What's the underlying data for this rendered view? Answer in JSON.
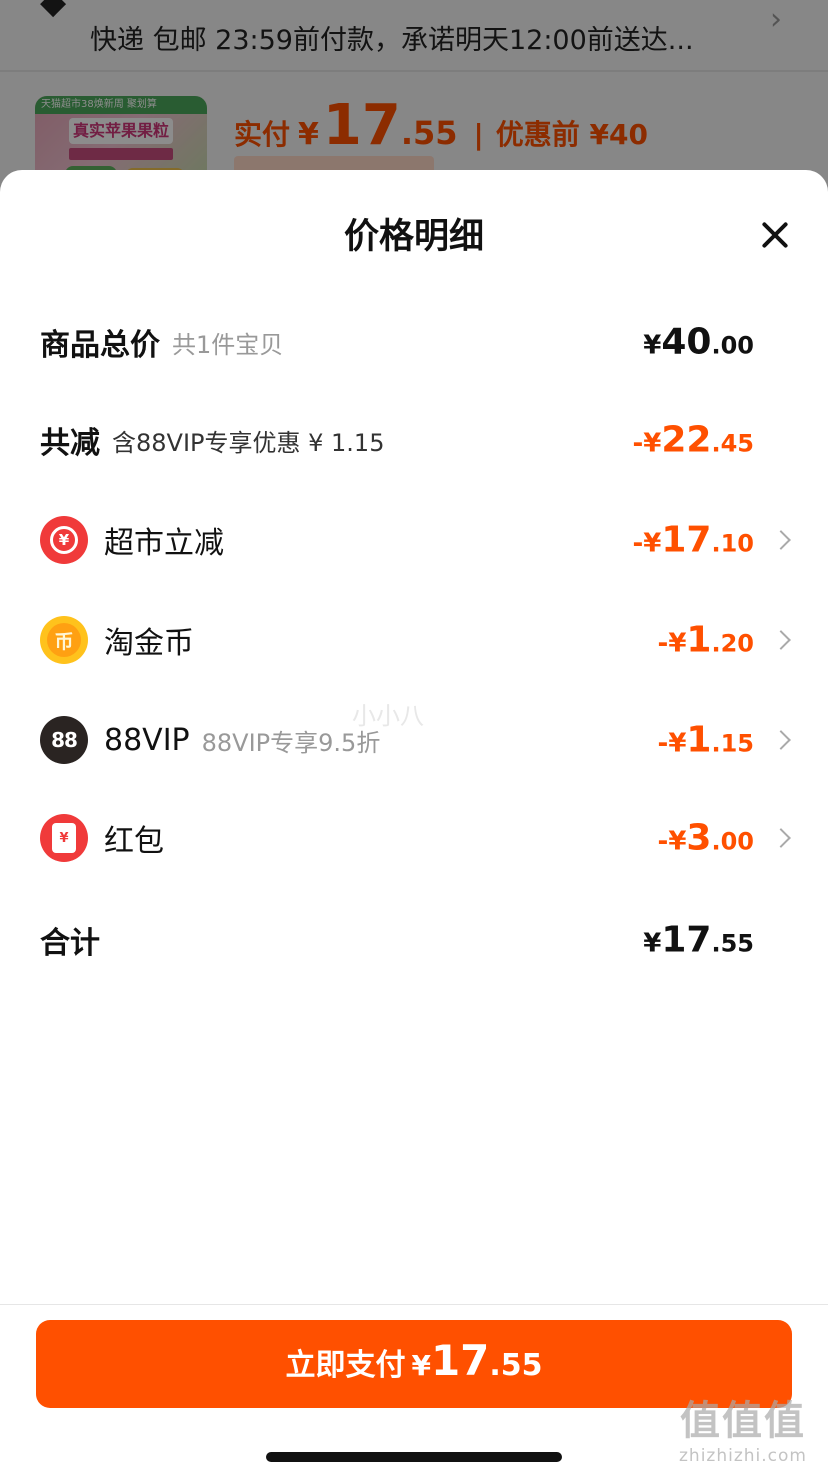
{
  "background": {
    "delivery_text": "快递 包邮 23:59前付款，承诺明天12:00前送达...",
    "product_thumb_title": "真实苹果果粒",
    "product_thumb_banner": "天猫超市38焕新周 聚划算",
    "price_label": "实付",
    "price_yen": "¥",
    "price_int": "17",
    "price_dec": ".55",
    "price_separator": "|",
    "price_before": "优惠前 ¥40"
  },
  "sheet": {
    "title": "价格明细",
    "rows": [
      {
        "label": "商品总价",
        "sub": "共1件宝贝",
        "sign": "¥",
        "int": "40",
        "dec": ".00"
      },
      {
        "label": "共减",
        "sub": "含88VIP专享优惠 ¥ 1.15",
        "sign": "-¥",
        "int": "22",
        "dec": ".45"
      },
      {
        "label": "超市立减",
        "sub": "",
        "sign": "-¥",
        "int": "17",
        "dec": ".10"
      },
      {
        "label": "淘金币",
        "sub": "",
        "sign": "-¥",
        "int": "1",
        "dec": ".20"
      },
      {
        "label": "88VIP",
        "sub": "88VIP专享9.5折",
        "sign": "-¥",
        "int": "1",
        "dec": ".15"
      },
      {
        "label": "红包",
        "sub": "",
        "sign": "-¥",
        "int": "3",
        "dec": ".00"
      },
      {
        "label": "合计",
        "sub": "",
        "sign": "¥",
        "int": "17",
        "dec": ".55"
      }
    ],
    "icons": {
      "supermarket": "¥",
      "gold_coin": "币",
      "vip": "88",
      "red_packet": "¥"
    },
    "pay_button": {
      "label": "立即支付",
      "yen": "¥",
      "int": "17",
      "dec": ".55"
    }
  },
  "watermark": {
    "middle": "小小八",
    "corner_big": "值值值",
    "corner_small": "zhizhizhi.com"
  },
  "colors": {
    "accent": "#ff5000",
    "text": "#111111",
    "muted": "#999999"
  }
}
